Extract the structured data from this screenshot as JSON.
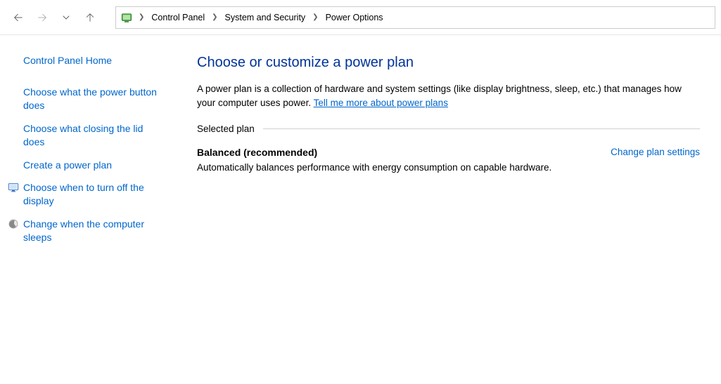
{
  "breadcrumb": {
    "items": [
      "Control Panel",
      "System and Security",
      "Power Options"
    ]
  },
  "sidebar": {
    "home": "Control Panel Home",
    "links": [
      {
        "label": "Choose what the power button does",
        "icon": null
      },
      {
        "label": "Choose what closing the lid does",
        "icon": null
      },
      {
        "label": "Create a power plan",
        "icon": null
      },
      {
        "label": "Choose when to turn off the display",
        "icon": "monitor"
      },
      {
        "label": "Change when the computer sleeps",
        "icon": "moon"
      }
    ]
  },
  "main": {
    "title": "Choose or customize a power plan",
    "description": "A power plan is a collection of hardware and system settings (like display brightness, sleep, etc.) that manages how your computer uses power. ",
    "description_link": "Tell me more about power plans",
    "section_label": "Selected plan",
    "plan": {
      "name": "Balanced (recommended)",
      "change_link": "Change plan settings",
      "description": "Automatically balances performance with energy consumption on capable hardware."
    }
  }
}
